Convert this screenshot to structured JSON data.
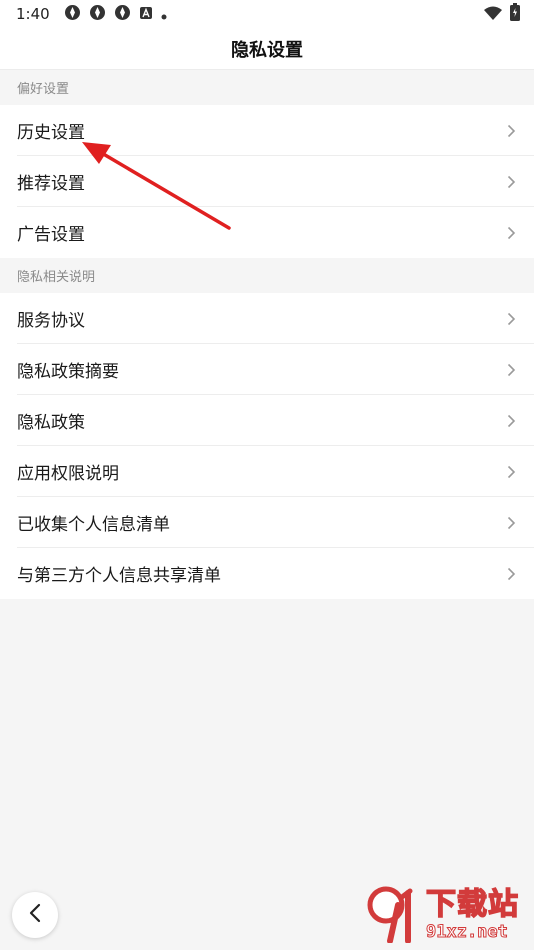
{
  "status_bar": {
    "time": "1:40",
    "left_icons": [
      "sync-icon",
      "sync-icon",
      "sync-icon",
      "a-box-icon",
      "dot-icon"
    ],
    "right_icons": [
      "wifi-icon",
      "battery-icon"
    ]
  },
  "header": {
    "title": "隐私设置"
  },
  "sections": [
    {
      "title": "偏好设置",
      "items": [
        {
          "label": "历史设置"
        },
        {
          "label": "推荐设置"
        },
        {
          "label": "广告设置"
        }
      ]
    },
    {
      "title": "隐私相关说明",
      "items": [
        {
          "label": "服务协议"
        },
        {
          "label": "隐私政策摘要"
        },
        {
          "label": "隐私政策"
        },
        {
          "label": "应用权限说明"
        },
        {
          "label": "已收集个人信息清单"
        },
        {
          "label": "与第三方个人信息共享清单"
        }
      ]
    }
  ],
  "watermark": {
    "text": "下载站",
    "domain": "91xz.net"
  },
  "colors": {
    "annotation": "#e02020",
    "watermark": "#d23b3b"
  }
}
